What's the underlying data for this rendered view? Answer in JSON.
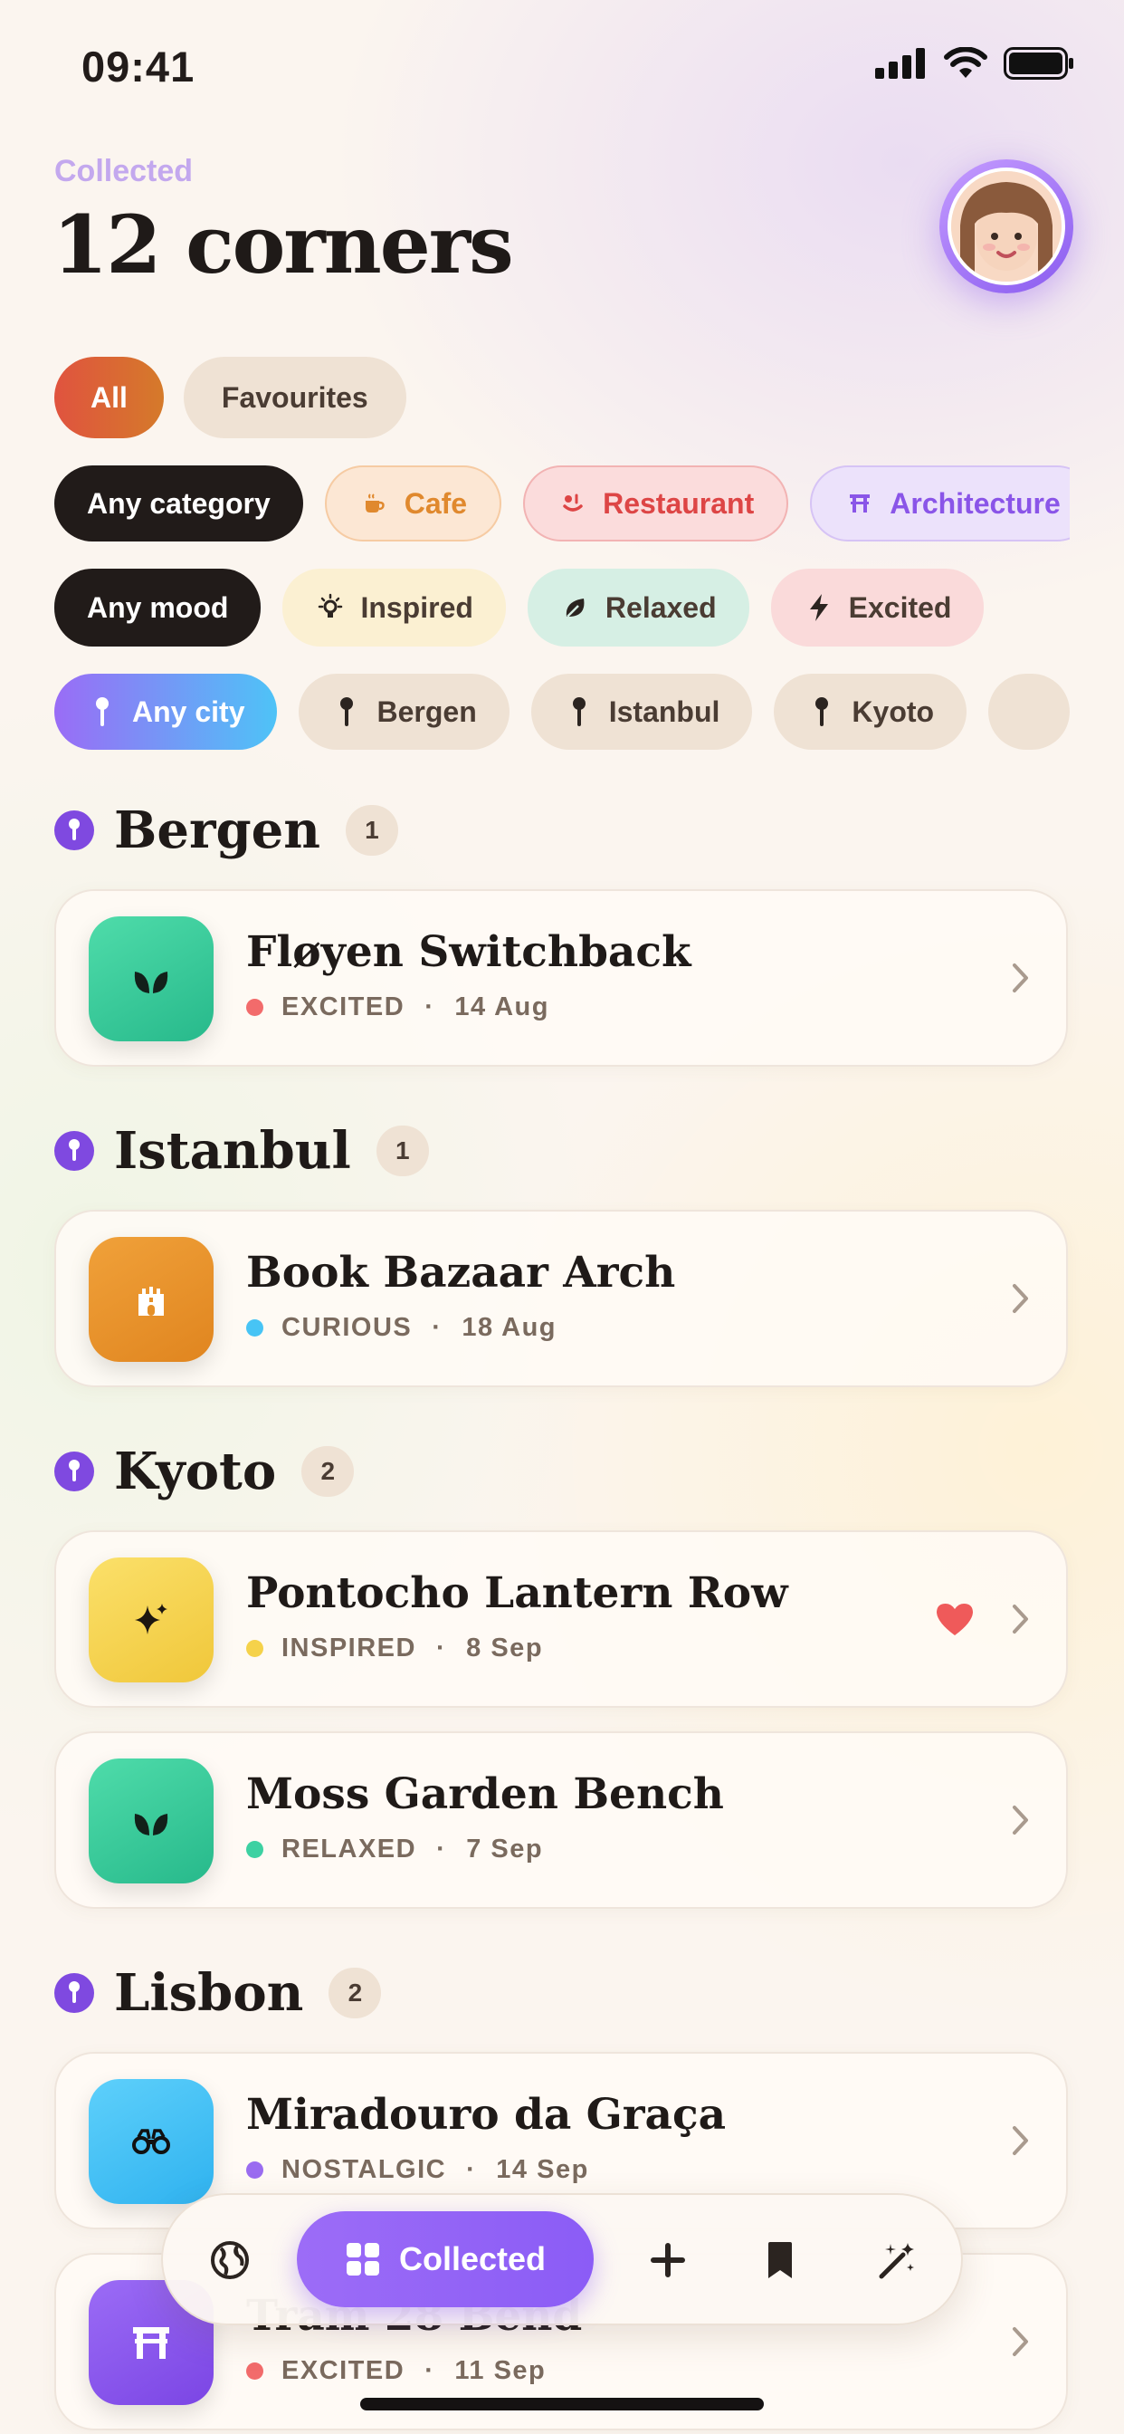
{
  "status_bar": {
    "time": "09:41"
  },
  "header": {
    "eyebrow": "Collected",
    "title": "12 corners"
  },
  "scope_filters": [
    {
      "label": "All",
      "active": true
    },
    {
      "label": "Favourites",
      "active": false
    }
  ],
  "category_filters": [
    {
      "label": "Any category",
      "active": true
    },
    {
      "label": "Cafe",
      "icon": "coffee-icon"
    },
    {
      "label": "Restaurant",
      "icon": "food-icon"
    },
    {
      "label": "Architecture",
      "icon": "arch-icon"
    }
  ],
  "mood_filters": [
    {
      "label": "Any mood",
      "active": true
    },
    {
      "label": "Inspired",
      "icon": "lightbulb-icon"
    },
    {
      "label": "Relaxed",
      "icon": "leaf-icon"
    },
    {
      "label": "Excited",
      "icon": "bolt-icon"
    }
  ],
  "city_filters": [
    {
      "label": "Any city",
      "active": true,
      "icon": "pin-icon"
    },
    {
      "label": "Bergen",
      "icon": "pin-icon"
    },
    {
      "label": "Istanbul",
      "icon": "pin-icon"
    },
    {
      "label": "Kyoto",
      "icon": "pin-icon"
    }
  ],
  "sections": [
    {
      "city": "Bergen",
      "count": "1",
      "items": [
        {
          "title": "Fløyen Switchback",
          "mood": "EXCITED",
          "date": "14 Aug",
          "mood_color": "#f26b6b",
          "icon": "leaf-icon",
          "favourite": false
        }
      ]
    },
    {
      "city": "Istanbul",
      "count": "1",
      "items": [
        {
          "title": "Book Bazaar Arch",
          "mood": "CURIOUS",
          "date": "18 Aug",
          "mood_color": "#47c4f5",
          "icon": "castle-icon",
          "favourite": false
        }
      ]
    },
    {
      "city": "Kyoto",
      "count": "2",
      "items": [
        {
          "title": "Pontocho Lantern Row",
          "mood": "INSPIRED",
          "date": "8 Sep",
          "mood_color": "#f5d24a",
          "icon": "sparkle-icon",
          "favourite": true
        },
        {
          "title": "Moss Garden Bench",
          "mood": "RELAXED",
          "date": "7 Sep",
          "mood_color": "#3dd1a2",
          "icon": "leaf-icon",
          "favourite": false
        }
      ]
    },
    {
      "city": "Lisbon",
      "count": "2",
      "items": [
        {
          "title": "Miradouro da Graça",
          "mood": "NOSTALGIC",
          "date": "14 Sep",
          "mood_color": "#9a6cf0",
          "icon": "binoculars-icon",
          "favourite": false
        },
        {
          "title": "Tram 28 Bend",
          "mood": "EXCITED",
          "date": "11 Sep",
          "mood_color": "#f26b6b",
          "icon": "arch-icon",
          "favourite": false
        }
      ]
    }
  ],
  "tab_bar": {
    "active_label": "Collected"
  }
}
